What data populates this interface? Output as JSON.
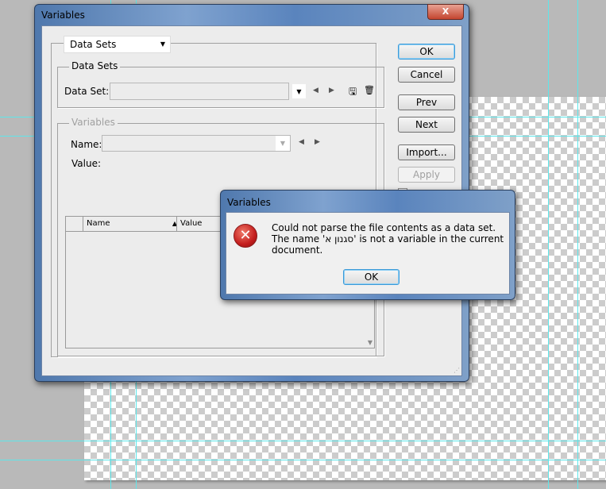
{
  "main_dialog": {
    "title": "Variables",
    "mode_dropdown": "Data Sets",
    "data_sets_group": {
      "label": "Data Sets",
      "data_set_label": "Data Set:",
      "data_set_value": ""
    },
    "variables_group": {
      "label": "Variables",
      "name_label": "Name:",
      "name_value": "",
      "value_label": "Value:"
    },
    "table": {
      "columns": [
        "Name",
        "Value"
      ],
      "sort_indicator": "▲",
      "rows": []
    },
    "buttons": {
      "ok": "OK",
      "cancel": "Cancel",
      "prev": "Prev",
      "next": "Next",
      "import": "Import...",
      "apply": "Apply"
    },
    "close": "X"
  },
  "error_dialog": {
    "title": "Variables",
    "message": "Could not parse the file contents as a data set. The name 'סגנון א' is not a variable in the current document.",
    "ok": "OK"
  }
}
